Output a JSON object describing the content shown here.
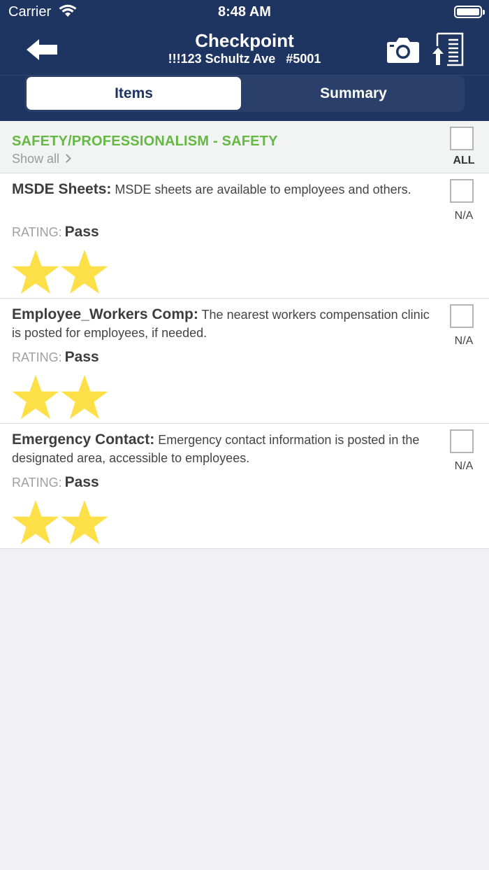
{
  "status_bar": {
    "carrier": "Carrier",
    "time": "8:48 AM"
  },
  "header": {
    "title": "Checkpoint",
    "subtitle": "!!!123 Schultz Ave   #5001"
  },
  "tabs": {
    "items_label": "Items",
    "summary_label": "Summary",
    "selected": "Items"
  },
  "section": {
    "title": "SAFETY/PROFESSIONALISM - SAFETY",
    "show_all_label": "Show all",
    "all_label": "ALL"
  },
  "items": [
    {
      "name": "MSDE Sheets:",
      "description": "MSDE sheets are available to employees and others.",
      "rating_label": "RATING:",
      "rating": "Pass",
      "stars": 2,
      "na_label": "N/A"
    },
    {
      "name": "Employee_Workers Comp:",
      "description": "The nearest workers compensation clinic is posted for employees, if needed.",
      "rating_label": "RATING:",
      "rating": "Pass",
      "stars": 2,
      "na_label": "N/A"
    },
    {
      "name": "Emergency Contact:",
      "description": "Emergency contact information is posted in the designated area, accessible to employees.",
      "rating_label": "RATING:",
      "rating": "Pass",
      "stars": 2,
      "na_label": "N/A"
    }
  ],
  "colors": {
    "header_bg": "#1e3461",
    "section_title": "#64b843",
    "star": "#fde047"
  },
  "icons": {
    "back": "back-arrow-icon",
    "camera": "camera-icon",
    "upload": "upload-document-icon",
    "show_all": "chevron-right-icon",
    "star": "star-icon"
  }
}
